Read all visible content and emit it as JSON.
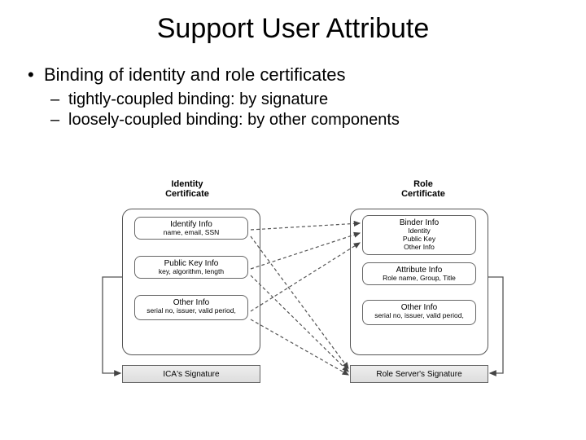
{
  "title": "Support User Attribute",
  "bullets": {
    "main": "Binding of identity and role certificates",
    "sub1": "tightly-coupled binding: by signature",
    "sub2": "loosely-coupled binding: by other components"
  },
  "diagram": {
    "left_label_line1": "Identity",
    "left_label_line2": "Certificate",
    "right_label_line1": "Role",
    "right_label_line2": "Certificate",
    "left_box1_t": "Identify Info",
    "left_box1_s": "name, email, SSN",
    "left_box2_t": "Public Key Info",
    "left_box2_s": "key, algorithm, length",
    "left_box3_t": "Other Info",
    "left_box3_s": "serial no, issuer, valid period,",
    "right_box1_t": "Binder Info",
    "right_box1_s": "Identity Public Key Other Info",
    "right_box2_t": "Attribute Info",
    "right_box2_s": "Role name, Group, Title",
    "right_box3_t": "Other Info",
    "right_box3_s": "serial no, issuer, valid period,",
    "left_sig": "ICA's Signature",
    "right_sig": "Role Server's Signature"
  }
}
